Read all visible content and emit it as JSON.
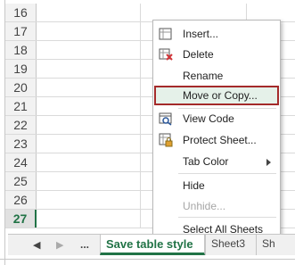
{
  "sheet": {
    "rows": [
      "16",
      "17",
      "18",
      "19",
      "20",
      "21",
      "22",
      "23",
      "24",
      "25",
      "26",
      "27"
    ],
    "active_row": "27"
  },
  "context_menu": {
    "items": [
      {
        "label": "Insert...",
        "icon": "insert-sheet-icon"
      },
      {
        "label": "Delete",
        "icon": "delete-sheet-icon"
      },
      {
        "label": "Rename",
        "icon": ""
      },
      {
        "label": "Move or Copy...",
        "icon": ""
      },
      {
        "label": "View Code",
        "icon": "view-code-icon"
      },
      {
        "label": "Protect Sheet...",
        "icon": "protect-sheet-icon"
      },
      {
        "label": "Tab Color",
        "icon": "",
        "submenu": true
      },
      {
        "label": "Hide",
        "icon": ""
      },
      {
        "label": "Unhide...",
        "icon": "",
        "disabled": true
      },
      {
        "label": "Select All Sheets",
        "icon": ""
      }
    ],
    "highlight_color": "#a42a2a"
  },
  "tab_bar": {
    "more_label": "...",
    "tabs": [
      "Save table style",
      "Sheet3",
      "Sh"
    ],
    "active_tab": "Save table style",
    "accent_color": "#217346"
  }
}
